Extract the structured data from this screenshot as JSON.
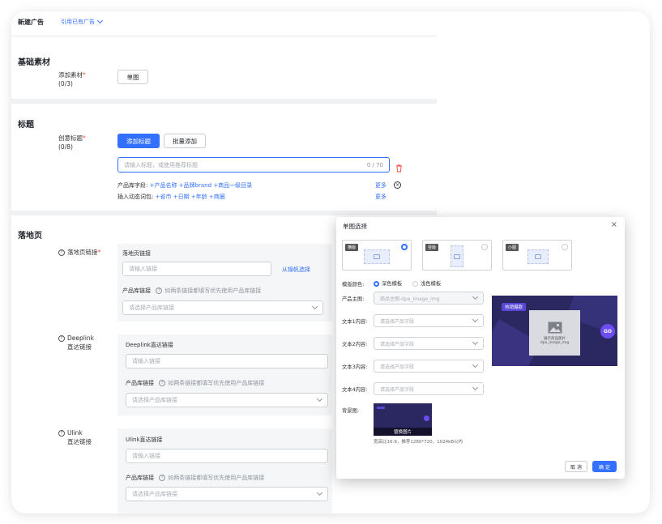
{
  "header": {
    "title": "新建广告",
    "cite_link": "引用已有广告"
  },
  "basic": {
    "section_title": "基础素材",
    "add_material_label": "添加素材",
    "add_material_count": "(0/3)",
    "single_image_button": "单图"
  },
  "headline": {
    "section_title": "标题",
    "creative_label": "创意标题",
    "creative_count": "(0/8)",
    "add_title_button": "添加标题",
    "batch_add_button": "批量添加",
    "title_placeholder": "请输入标题，或使用推荐标题",
    "char_count": "0 / 70",
    "product_fields_label": "产品库字段:",
    "product_fields": [
      "+产品名称",
      "+品牌brand",
      "+商品一级目录"
    ],
    "dynamic_words_label": "插入动态词包:",
    "dynamic_words": [
      "+省市",
      "+日期",
      "+年龄",
      "+商圈"
    ],
    "more_1": "更多",
    "more_2": "更多"
  },
  "landing": {
    "section_title": "落地页",
    "page_link_label": "落地页链接",
    "page_link_box_title": "落地页链接",
    "page_link_placeholder": "请输入链接",
    "pick_from_site": "从锦帆选择",
    "product_link_label": "产品库链接",
    "product_link_hint": "如两条链接都填写优先使用产品库链接",
    "product_link_placeholder": "请选择产品库链接",
    "deeplink_label_1": "Deeplink",
    "deeplink_label_2": "直达链接",
    "deeplink_box_title": "Deeplink直达链接",
    "deeplink_placeholder": "请输入链接",
    "deeplink_product_label": "产品库链接",
    "deeplink_product_hint": "如两条链接都填写优先使用产品库链接",
    "deeplink_product_placeholder": "请选择产品库链接",
    "ulink_label_1": "Ulink",
    "ulink_label_2": "直达链接",
    "ulink_box_title": "Ulink直达链接",
    "ulink_placeholder": "请输入链接",
    "ulink_product_label": "产品库链接",
    "ulink_product_hint": "如两条链接都填写优先使用产品库链接",
    "ulink_product_placeholder": "请选择产品库链接"
  },
  "dialog": {
    "title": "单图选择",
    "templates": [
      {
        "tag": "横版",
        "selected": true
      },
      {
        "tag": "竖版",
        "selected": false
      },
      {
        "tag": "小图",
        "selected": false
      }
    ],
    "template_color_label": "模版颜色:",
    "color_dark": "深色模板",
    "color_light": "浅色模板",
    "product_image_label": "产品主图:",
    "product_image_value": "商品主图-dpa_image_img",
    "text1_label": "文本1内容:",
    "text2_label": "文本2内容:",
    "text3_label": "文本3内容:",
    "text4_label": "文本4内容:",
    "text_placeholder": "请选择产品字段",
    "preview_badge": "热销爆款",
    "preview_caption_1": "展示商品图片",
    "preview_caption_2": "dpa_image_img",
    "preview_go": "GO",
    "background_label": "背景图:",
    "replace_image": "替换图片",
    "bg_hint": "宽高比16:9，推荐1280*720，1024kB以内",
    "cancel_button": "取 消",
    "confirm_button": "确 定",
    "colors": {
      "primary": "#3370ff",
      "preview_bg": "#2b2760",
      "go": "#6c4cf5"
    }
  }
}
